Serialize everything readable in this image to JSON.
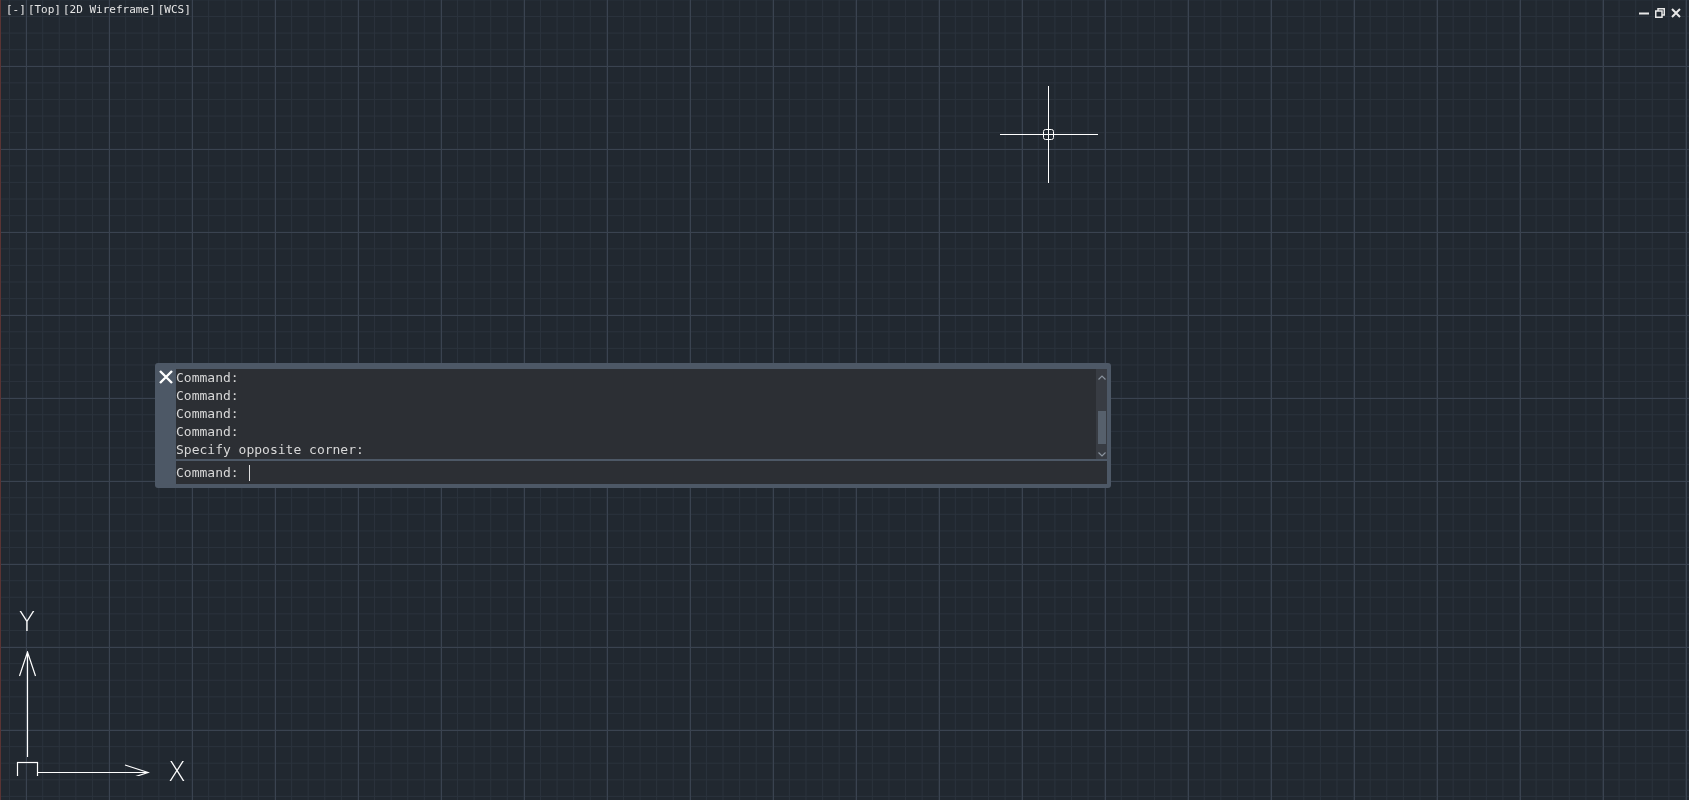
{
  "viewport": {
    "controls": [
      "[-]",
      "[Top]",
      "[2D Wireframe]",
      "[WCS]"
    ]
  },
  "command_window": {
    "history": [
      "Command:",
      "Command:",
      "Command:",
      "Command:",
      "Specify opposite corner:"
    ],
    "prompt": "Command:"
  },
  "ucs_icon": {
    "x_label": "X",
    "y_label": "Y"
  }
}
